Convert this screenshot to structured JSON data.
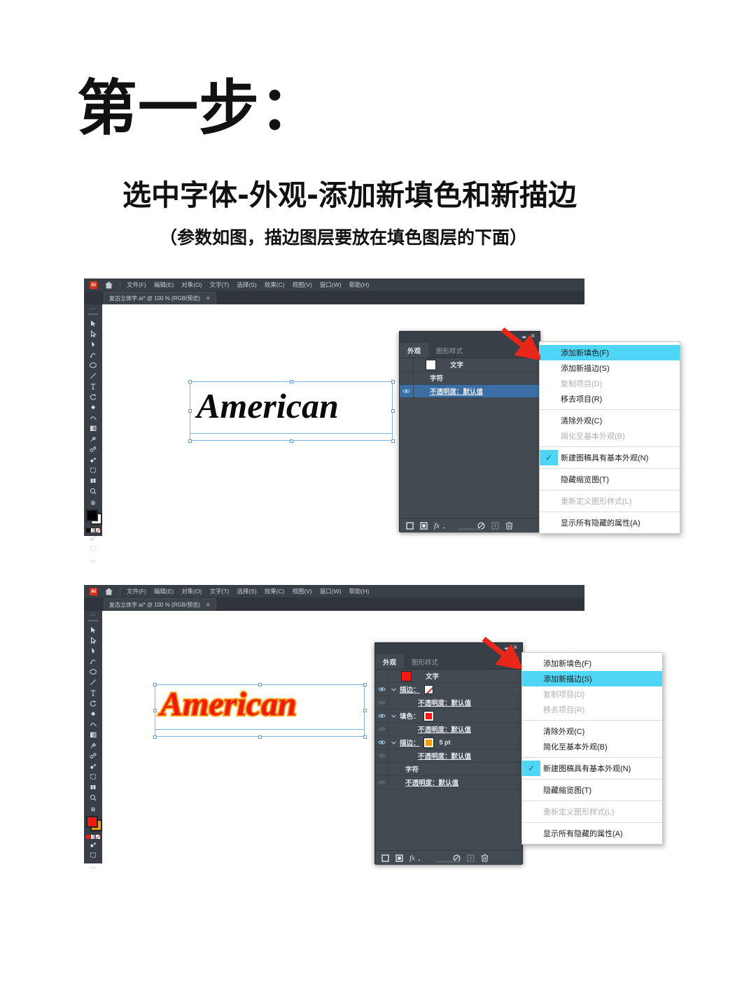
{
  "header": {
    "title": "第一步：",
    "subtitle": "选中字体-外观-添加新填色和新描边",
    "note": "（参数如图，描边图层要放在填色图层的下面）"
  },
  "colors": {
    "menu_highlight": "#4fd6f7",
    "row_selected": "#3a6ea5",
    "panel_bg": "#424a52",
    "chrome_bg": "#383f46",
    "art_fill_red": "#f01a11",
    "art_stroke_orange": "#f79a0e",
    "arrow_red": "#e8261a"
  },
  "app": {
    "logo_label": "Ai",
    "home_icon": "home-icon",
    "menus": [
      "文件(F)",
      "编辑(E)",
      "对象(O)",
      "文字(T)",
      "选择(S)",
      "效果(C)",
      "视图(V)",
      "窗口(W)",
      "帮助(H)"
    ],
    "tab": {
      "label": "复古立体字.ai* @ 100 % (RGB/预览)",
      "close": "✕"
    },
    "tools": [
      "selection-tool",
      "direct-selection-tool",
      "pen-tool",
      "curvature-tool",
      "ellipse-tool",
      "line-tool",
      "type-tool",
      "rotate-tool",
      "paintbucket-tool",
      "shaper-tool",
      "gradient-tool",
      "eyedropper-tool",
      "blend-tool",
      "symbol-sprayer-tool",
      "artboard-tool",
      "slice-tool",
      "zoom-tool",
      "hand-tool"
    ],
    "tool_more": "⋯"
  },
  "panel": {
    "collapse_icon": "collapse-chevrons-icon",
    "close_icon": "close-icon",
    "menu_icon": "panel-menu-icon",
    "tabs": [
      {
        "label": "外观",
        "active": true
      },
      {
        "label": "图形样式",
        "active": false
      }
    ],
    "footer_buttons": [
      "add-new-stroke-icon",
      "add-new-fill-icon",
      "add-effect-fx-icon",
      "clear-appearance-icon",
      "duplicate-item-icon",
      "delete-item-icon"
    ]
  },
  "screenshot1": {
    "artwork_text": "American",
    "rows": [
      {
        "name": "文字",
        "type": "thumb",
        "swatch": "#ffffff",
        "eye": false,
        "caret": false,
        "selected": false,
        "indent": 0
      },
      {
        "name": "字符",
        "type": "plain",
        "eye": false,
        "caret": false,
        "selected": false,
        "indent": 1
      },
      {
        "name": "不透明度：默认值",
        "type": "opacity",
        "eye": true,
        "caret": false,
        "selected": true,
        "indent": 1
      }
    ],
    "menu_items": [
      {
        "label": "添加新填色(F)",
        "state": "highlight"
      },
      {
        "label": "添加新描边(S)",
        "state": "normal"
      },
      {
        "label": "复制项目(D)",
        "state": "disabled"
      },
      {
        "label": "移去项目(R)",
        "state": "normal"
      },
      {
        "sep": true
      },
      {
        "label": "清除外观(C)",
        "state": "normal"
      },
      {
        "label": "简化至基本外观(B)",
        "state": "disabled"
      },
      {
        "sep": true
      },
      {
        "label": "新建图稿具有基本外观(N)",
        "state": "checked"
      },
      {
        "sep": true
      },
      {
        "label": "隐藏缩览图(T)",
        "state": "normal"
      },
      {
        "sep": true
      },
      {
        "label": "重新定义图形样式(L)",
        "state": "disabled"
      },
      {
        "sep": true
      },
      {
        "label": "显示所有隐藏的属性(A)",
        "state": "normal"
      }
    ]
  },
  "screenshot2": {
    "artwork_text": "American",
    "rows": [
      {
        "name": "文字",
        "type": "thumb",
        "swatch": "#f01a11",
        "eye": false,
        "caret": false,
        "selected": false,
        "indent": 0
      },
      {
        "name": "描边：",
        "type": "swatch-none",
        "eye": true,
        "caret": true,
        "selected": false,
        "indent": 0,
        "underline": true
      },
      {
        "name": "不透明度：默认值",
        "type": "opacity",
        "eye": true,
        "dim": true,
        "caret": false,
        "selected": false,
        "indent": 2
      },
      {
        "name": "填色：",
        "type": "swatch",
        "swatch": "#f01a11",
        "eye": true,
        "caret": true,
        "selected": false,
        "indent": 0
      },
      {
        "name": "不透明度：默认值",
        "type": "opacity",
        "eye": true,
        "dim": true,
        "caret": false,
        "selected": false,
        "indent": 2
      },
      {
        "name": "描边：",
        "type": "swatch-weight",
        "swatch": "#f79a0e",
        "weight": "5 pt",
        "eye": true,
        "caret": true,
        "selected": false,
        "indent": 0,
        "underline": true
      },
      {
        "name": "不透明度：默认值",
        "type": "opacity",
        "eye": true,
        "dim": true,
        "caret": false,
        "selected": false,
        "indent": 2
      },
      {
        "name": "字符",
        "type": "plain",
        "eye": false,
        "caret": false,
        "selected": false,
        "indent": 1
      },
      {
        "name": "不透明度：默认值",
        "type": "opacity",
        "eye": true,
        "dim": true,
        "caret": false,
        "selected": false,
        "indent": 1
      }
    ],
    "menu_items": [
      {
        "label": "添加新填色(F)",
        "state": "normal"
      },
      {
        "label": "添加新描边(S)",
        "state": "highlight"
      },
      {
        "label": "复制项目(D)",
        "state": "disabled"
      },
      {
        "label": "移去项目(R)",
        "state": "disabled"
      },
      {
        "sep": true
      },
      {
        "label": "清除外观(C)",
        "state": "normal"
      },
      {
        "label": "简化至基本外观(B)",
        "state": "normal"
      },
      {
        "sep": true
      },
      {
        "label": "新建图稿具有基本外观(N)",
        "state": "checked"
      },
      {
        "sep": true
      },
      {
        "label": "隐藏缩览图(T)",
        "state": "normal"
      },
      {
        "sep": true
      },
      {
        "label": "重新定义图形样式(L)",
        "state": "disabled"
      },
      {
        "sep": true
      },
      {
        "label": "显示所有隐藏的属性(A)",
        "state": "normal"
      }
    ]
  }
}
